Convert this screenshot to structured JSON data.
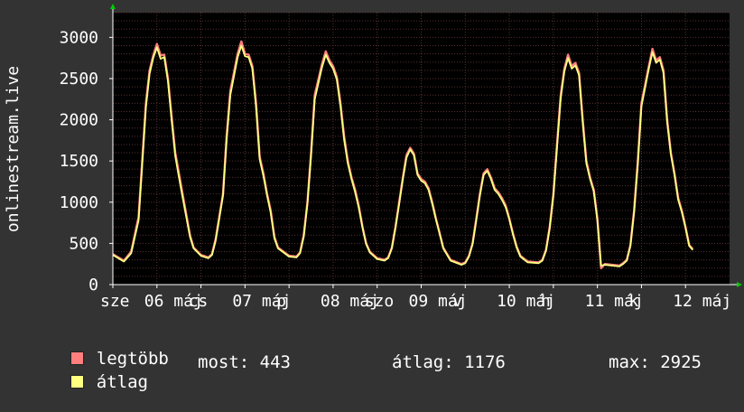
{
  "chart_data": {
    "type": "line",
    "ylabel": "onlinestream.live",
    "ylim": [
      0,
      3300
    ],
    "yticks": [
      0,
      500,
      1000,
      1500,
      2000,
      2500,
      3000
    ],
    "ytick_labels": [
      "0",
      "500",
      "1000",
      "1500",
      "2000",
      "2500",
      "3000"
    ],
    "xlim": [
      0,
      168
    ],
    "xtick_labels": [
      {
        "x": 0,
        "label": "sze"
      },
      {
        "x": 12,
        "label": "06 máj"
      },
      {
        "x": 24,
        "label": "cs"
      },
      {
        "x": 36,
        "label": "07 máj"
      },
      {
        "x": 48,
        "label": "p"
      },
      {
        "x": 60,
        "label": "08 máj"
      },
      {
        "x": 72,
        "label": "szo"
      },
      {
        "x": 84,
        "label": "09 máj"
      },
      {
        "x": 96,
        "label": "v"
      },
      {
        "x": 108,
        "label": "10 máj"
      },
      {
        "x": 120,
        "label": "h"
      },
      {
        "x": 132,
        "label": "11 máj"
      },
      {
        "x": 144,
        "label": "k"
      },
      {
        "x": 156,
        "label": "12 máj"
      }
    ],
    "grid": true,
    "series": [
      {
        "name": "legtöbb",
        "color": "#ff7f7f",
        "points": [
          [
            0,
            370
          ],
          [
            3,
            290
          ],
          [
            5,
            400
          ],
          [
            7,
            820
          ],
          [
            8,
            1500
          ],
          [
            9,
            2200
          ],
          [
            10,
            2600
          ],
          [
            11,
            2780
          ],
          [
            12,
            2920
          ],
          [
            13,
            2780
          ],
          [
            14,
            2790
          ],
          [
            15,
            2500
          ],
          [
            16,
            2050
          ],
          [
            17,
            1600
          ],
          [
            18,
            1350
          ],
          [
            19,
            1100
          ],
          [
            20,
            850
          ],
          [
            21,
            600
          ],
          [
            22,
            450
          ],
          [
            24,
            360
          ],
          [
            26,
            330
          ],
          [
            27,
            370
          ],
          [
            28,
            550
          ],
          [
            30,
            1100
          ],
          [
            31,
            1800
          ],
          [
            32,
            2350
          ],
          [
            34,
            2800
          ],
          [
            35,
            2950
          ],
          [
            36,
            2800
          ],
          [
            37,
            2790
          ],
          [
            38,
            2650
          ],
          [
            39,
            2200
          ],
          [
            40,
            1550
          ],
          [
            41,
            1350
          ],
          [
            42,
            1100
          ],
          [
            43,
            900
          ],
          [
            44,
            580
          ],
          [
            45,
            450
          ],
          [
            48,
            350
          ],
          [
            50,
            340
          ],
          [
            51,
            390
          ],
          [
            52,
            600
          ],
          [
            53,
            1000
          ],
          [
            54,
            1600
          ],
          [
            55,
            2300
          ],
          [
            57,
            2680
          ],
          [
            58,
            2830
          ],
          [
            59,
            2720
          ],
          [
            60,
            2650
          ],
          [
            61,
            2520
          ],
          [
            62,
            2200
          ],
          [
            63,
            1800
          ],
          [
            64,
            1500
          ],
          [
            65,
            1300
          ],
          [
            66,
            1150
          ],
          [
            67,
            950
          ],
          [
            68,
            700
          ],
          [
            69,
            500
          ],
          [
            70,
            400
          ],
          [
            72,
            320
          ],
          [
            74,
            300
          ],
          [
            75,
            330
          ],
          [
            76,
            450
          ],
          [
            77,
            700
          ],
          [
            78,
            1000
          ],
          [
            79,
            1300
          ],
          [
            80,
            1570
          ],
          [
            81,
            1660
          ],
          [
            82,
            1590
          ],
          [
            83,
            1350
          ],
          [
            84,
            1280
          ],
          [
            85,
            1250
          ],
          [
            86,
            1170
          ],
          [
            87,
            1000
          ],
          [
            88,
            800
          ],
          [
            89,
            630
          ],
          [
            90,
            450
          ],
          [
            92,
            300
          ],
          [
            95,
            250
          ],
          [
            96,
            270
          ],
          [
            97,
            350
          ],
          [
            98,
            500
          ],
          [
            99,
            800
          ],
          [
            100,
            1100
          ],
          [
            101,
            1350
          ],
          [
            102,
            1400
          ],
          [
            103,
            1300
          ],
          [
            104,
            1170
          ],
          [
            105,
            1120
          ],
          [
            106,
            1050
          ],
          [
            107,
            960
          ],
          [
            108,
            800
          ],
          [
            109,
            620
          ],
          [
            110,
            460
          ],
          [
            111,
            350
          ],
          [
            113,
            280
          ],
          [
            116,
            270
          ],
          [
            117,
            300
          ],
          [
            118,
            420
          ],
          [
            119,
            700
          ],
          [
            120,
            1100
          ],
          [
            121,
            1700
          ],
          [
            122,
            2300
          ],
          [
            123,
            2620
          ],
          [
            124,
            2790
          ],
          [
            125,
            2650
          ],
          [
            126,
            2690
          ],
          [
            127,
            2570
          ],
          [
            128,
            2000
          ],
          [
            129,
            1500
          ],
          [
            130,
            1300
          ],
          [
            131,
            1150
          ],
          [
            132,
            800
          ],
          [
            133,
            200
          ],
          [
            134,
            250
          ],
          [
            138,
            230
          ],
          [
            139,
            260
          ],
          [
            140,
            300
          ],
          [
            141,
            480
          ],
          [
            142,
            900
          ],
          [
            143,
            1500
          ],
          [
            144,
            2200
          ],
          [
            146,
            2650
          ],
          [
            147,
            2860
          ],
          [
            148,
            2720
          ],
          [
            149,
            2760
          ],
          [
            150,
            2600
          ],
          [
            151,
            2000
          ],
          [
            152,
            1600
          ],
          [
            153,
            1350
          ],
          [
            154,
            1050
          ],
          [
            155,
            900
          ],
          [
            156,
            700
          ],
          [
            157,
            480
          ],
          [
            158,
            430
          ]
        ]
      },
      {
        "name": "átlag",
        "color": "#ffff80",
        "points": [
          [
            0,
            360
          ],
          [
            3,
            280
          ],
          [
            5,
            380
          ],
          [
            7,
            780
          ],
          [
            8,
            1450
          ],
          [
            9,
            2150
          ],
          [
            10,
            2560
          ],
          [
            11,
            2750
          ],
          [
            12,
            2880
          ],
          [
            13,
            2740
          ],
          [
            14,
            2760
          ],
          [
            15,
            2470
          ],
          [
            16,
            2000
          ],
          [
            17,
            1560
          ],
          [
            18,
            1300
          ],
          [
            19,
            1060
          ],
          [
            20,
            820
          ],
          [
            21,
            580
          ],
          [
            22,
            440
          ],
          [
            24,
            350
          ],
          [
            26,
            320
          ],
          [
            27,
            360
          ],
          [
            28,
            530
          ],
          [
            30,
            1080
          ],
          [
            31,
            1760
          ],
          [
            32,
            2300
          ],
          [
            34,
            2760
          ],
          [
            35,
            2900
          ],
          [
            36,
            2770
          ],
          [
            37,
            2760
          ],
          [
            38,
            2620
          ],
          [
            39,
            2150
          ],
          [
            40,
            1520
          ],
          [
            41,
            1320
          ],
          [
            42,
            1080
          ],
          [
            43,
            870
          ],
          [
            44,
            560
          ],
          [
            45,
            440
          ],
          [
            48,
            340
          ],
          [
            50,
            330
          ],
          [
            51,
            380
          ],
          [
            52,
            580
          ],
          [
            53,
            980
          ],
          [
            54,
            1560
          ],
          [
            55,
            2250
          ],
          [
            57,
            2640
          ],
          [
            58,
            2790
          ],
          [
            59,
            2690
          ],
          [
            60,
            2620
          ],
          [
            61,
            2490
          ],
          [
            62,
            2160
          ],
          [
            63,
            1760
          ],
          [
            64,
            1470
          ],
          [
            65,
            1280
          ],
          [
            66,
            1120
          ],
          [
            67,
            930
          ],
          [
            68,
            690
          ],
          [
            69,
            490
          ],
          [
            70,
            390
          ],
          [
            72,
            310
          ],
          [
            74,
            290
          ],
          [
            75,
            320
          ],
          [
            76,
            440
          ],
          [
            77,
            690
          ],
          [
            78,
            980
          ],
          [
            79,
            1280
          ],
          [
            80,
            1540
          ],
          [
            81,
            1640
          ],
          [
            82,
            1570
          ],
          [
            83,
            1330
          ],
          [
            84,
            1260
          ],
          [
            85,
            1230
          ],
          [
            86,
            1150
          ],
          [
            87,
            980
          ],
          [
            88,
            790
          ],
          [
            89,
            620
          ],
          [
            90,
            440
          ],
          [
            92,
            290
          ],
          [
            95,
            240
          ],
          [
            96,
            260
          ],
          [
            97,
            340
          ],
          [
            98,
            490
          ],
          [
            99,
            780
          ],
          [
            100,
            1080
          ],
          [
            101,
            1330
          ],
          [
            102,
            1380
          ],
          [
            103,
            1280
          ],
          [
            104,
            1150
          ],
          [
            105,
            1100
          ],
          [
            106,
            1030
          ],
          [
            107,
            940
          ],
          [
            108,
            790
          ],
          [
            109,
            610
          ],
          [
            110,
            450
          ],
          [
            111,
            340
          ],
          [
            113,
            270
          ],
          [
            116,
            260
          ],
          [
            117,
            290
          ],
          [
            118,
            410
          ],
          [
            119,
            680
          ],
          [
            120,
            1080
          ],
          [
            121,
            1660
          ],
          [
            122,
            2260
          ],
          [
            123,
            2590
          ],
          [
            124,
            2750
          ],
          [
            125,
            2620
          ],
          [
            126,
            2660
          ],
          [
            127,
            2540
          ],
          [
            128,
            1960
          ],
          [
            129,
            1470
          ],
          [
            130,
            1280
          ],
          [
            131,
            1130
          ],
          [
            132,
            780
          ],
          [
            133,
            230
          ],
          [
            134,
            240
          ],
          [
            138,
            220
          ],
          [
            139,
            250
          ],
          [
            140,
            290
          ],
          [
            141,
            470
          ],
          [
            142,
            880
          ],
          [
            143,
            1460
          ],
          [
            144,
            2160
          ],
          [
            146,
            2620
          ],
          [
            147,
            2820
          ],
          [
            148,
            2690
          ],
          [
            149,
            2730
          ],
          [
            150,
            2570
          ],
          [
            151,
            1970
          ],
          [
            152,
            1580
          ],
          [
            153,
            1330
          ],
          [
            154,
            1030
          ],
          [
            155,
            880
          ],
          [
            156,
            690
          ],
          [
            157,
            470
          ],
          [
            158,
            420
          ]
        ]
      }
    ]
  },
  "stats": {
    "now_label": "most:",
    "now_value": "443",
    "avg_label": "átlag:",
    "avg_value": "1176",
    "max_label": "max:",
    "max_value": "2925"
  },
  "colors": {
    "background": "#333333",
    "plot_background": "#000000",
    "grid": "#5a3030",
    "axis": "#ffffff",
    "arrow": "#00cc00"
  }
}
